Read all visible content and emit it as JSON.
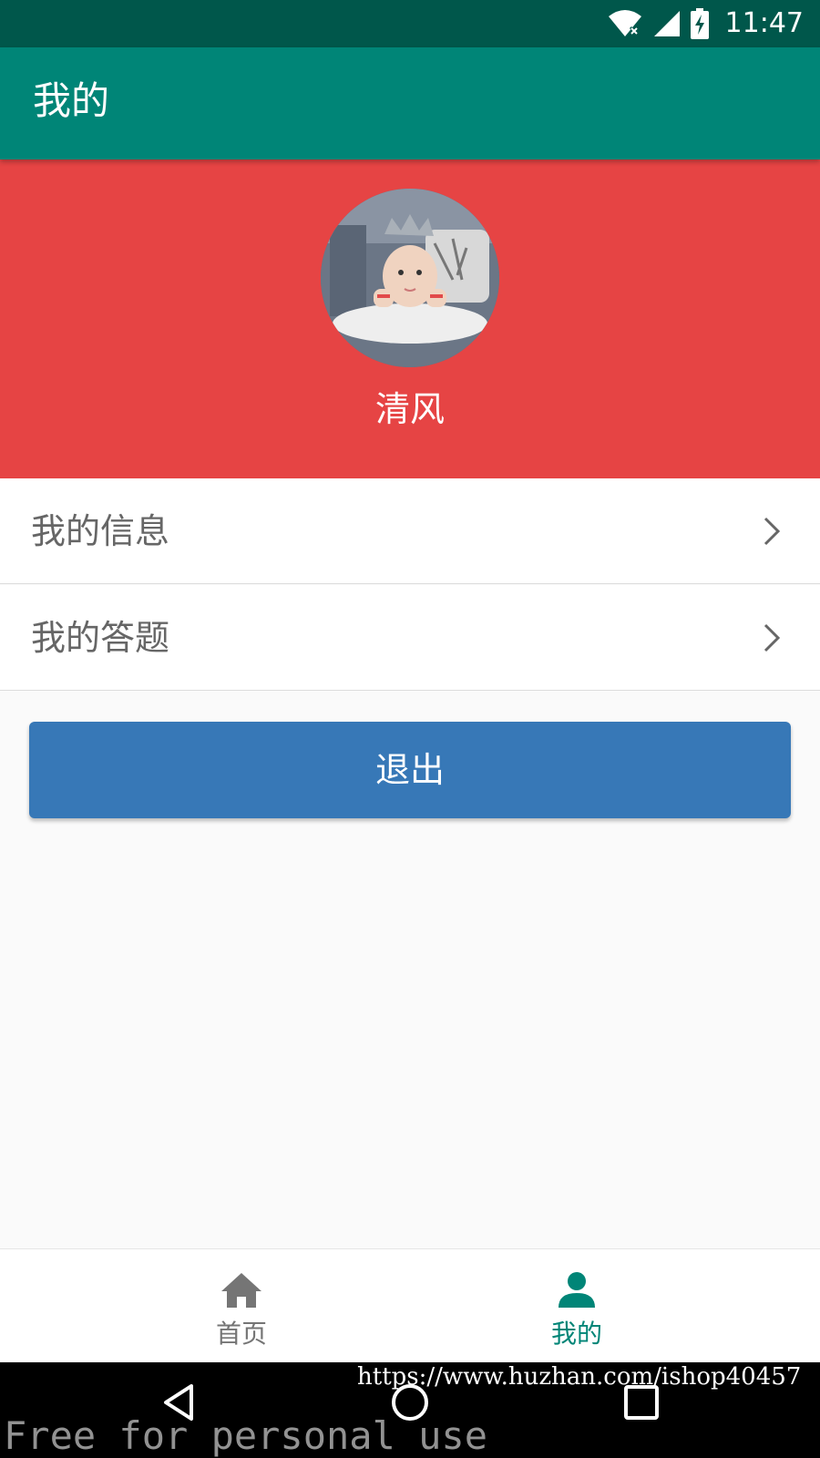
{
  "status_bar": {
    "time": "11:47",
    "icons": [
      "wifi-icon",
      "cellular-signal-icon",
      "battery-charging-icon"
    ]
  },
  "app_bar": {
    "title": "我的"
  },
  "profile": {
    "avatar": "avatar-photo-baby",
    "name": "清风"
  },
  "menu": [
    {
      "label": "我的信息",
      "icon": "chevron-right-icon"
    },
    {
      "label": "我的答题",
      "icon": "chevron-right-icon"
    }
  ],
  "logout_label": "退出",
  "bottom_nav": [
    {
      "label": "首页",
      "icon": "home-icon",
      "active": false
    },
    {
      "label": "我的",
      "icon": "person-icon",
      "active": true
    }
  ],
  "system_nav": [
    "back-icon",
    "home-circle-icon",
    "recents-icon"
  ],
  "watermark": {
    "url": "https://www.huzhan.com/ishop40457",
    "text": "Free for personal use"
  },
  "colors": {
    "status_bar": "#00574b",
    "app_bar": "#008577",
    "header": "#e64444",
    "button": "#3778b7",
    "nav_active": "#008577",
    "nav_inactive": "#757575"
  }
}
